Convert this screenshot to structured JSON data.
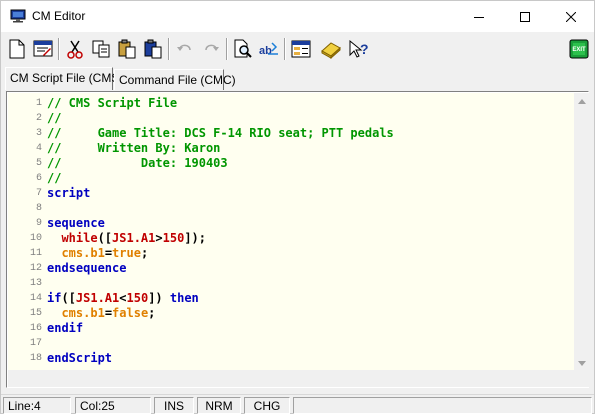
{
  "window": {
    "title": "CM Editor"
  },
  "toolbar": {
    "buttons": [
      {
        "name": "new-file-icon"
      },
      {
        "name": "open-editor-icon"
      },
      {
        "name": "cut-icon"
      },
      {
        "name": "copy-icon"
      },
      {
        "name": "paste-icon"
      },
      {
        "name": "paste-special-icon"
      },
      {
        "name": "undo-icon"
      },
      {
        "name": "redo-icon"
      },
      {
        "name": "find-icon"
      },
      {
        "name": "replace-icon"
      },
      {
        "name": "settings-window-icon"
      },
      {
        "name": "compile-icon"
      },
      {
        "name": "help-icon"
      },
      {
        "name": "exit-icon"
      }
    ],
    "exit_label": "EXIT"
  },
  "tabs": [
    {
      "label": "CM Script File (CMS)",
      "active": true
    },
    {
      "label": "Command File (CMC)",
      "active": false
    }
  ],
  "colors": {
    "comment": "#009600",
    "keyword": "#0000c0",
    "function": "#c00000",
    "variable": "#e08000",
    "background": "#fffff0"
  },
  "editor": {
    "lines": [
      {
        "num": "1",
        "segments": [
          {
            "t": "// CMS Script File",
            "c": "comment"
          }
        ]
      },
      {
        "num": "2",
        "segments": [
          {
            "t": "//",
            "c": "comment"
          }
        ]
      },
      {
        "num": "3",
        "segments": [
          {
            "t": "//     Game Title: DCS F-14 RIO seat; PTT pedals",
            "c": "comment"
          }
        ]
      },
      {
        "num": "4",
        "segments": [
          {
            "t": "//     Written By: Karon",
            "c": "comment"
          }
        ]
      },
      {
        "num": "5",
        "segments": [
          {
            "t": "//           Date: 190403",
            "c": "comment"
          }
        ]
      },
      {
        "num": "6",
        "segments": [
          {
            "t": "//",
            "c": "comment"
          }
        ]
      },
      {
        "num": "7",
        "segments": [
          {
            "t": "script",
            "c": "kw"
          }
        ]
      },
      {
        "num": "8",
        "segments": []
      },
      {
        "num": "9",
        "segments": [
          {
            "t": "sequence",
            "c": "kw"
          }
        ]
      },
      {
        "num": "10",
        "segments": [
          {
            "t": "  ",
            "c": "plain"
          },
          {
            "t": "while",
            "c": "fn"
          },
          {
            "t": "([",
            "c": "plain"
          },
          {
            "t": "JS1.A1",
            "c": "fn"
          },
          {
            "t": ">",
            "c": "plain"
          },
          {
            "t": "150",
            "c": "num"
          },
          {
            "t": "]);",
            "c": "plain"
          }
        ]
      },
      {
        "num": "11",
        "segments": [
          {
            "t": "  ",
            "c": "plain"
          },
          {
            "t": "cms.b1",
            "c": "var"
          },
          {
            "t": "=",
            "c": "plain"
          },
          {
            "t": "true",
            "c": "var"
          },
          {
            "t": ";",
            "c": "plain"
          }
        ]
      },
      {
        "num": "12",
        "segments": [
          {
            "t": "endsequence",
            "c": "kw"
          }
        ]
      },
      {
        "num": "13",
        "segments": []
      },
      {
        "num": "14",
        "segments": [
          {
            "t": "if",
            "c": "kw"
          },
          {
            "t": "([",
            "c": "plain"
          },
          {
            "t": "JS1.A1",
            "c": "fn"
          },
          {
            "t": "<",
            "c": "plain"
          },
          {
            "t": "150",
            "c": "num"
          },
          {
            "t": "]) ",
            "c": "plain"
          },
          {
            "t": "then",
            "c": "kw"
          }
        ]
      },
      {
        "num": "15",
        "segments": [
          {
            "t": "  ",
            "c": "plain"
          },
          {
            "t": "cms.b1",
            "c": "var"
          },
          {
            "t": "=",
            "c": "plain"
          },
          {
            "t": "false",
            "c": "var"
          },
          {
            "t": ";",
            "c": "plain"
          }
        ]
      },
      {
        "num": "16",
        "segments": [
          {
            "t": "endif",
            "c": "kw"
          }
        ]
      },
      {
        "num": "17",
        "segments": []
      },
      {
        "num": "18",
        "segments": [
          {
            "t": "endScript",
            "c": "kw"
          }
        ]
      }
    ]
  },
  "status": {
    "line": "Line:4",
    "col": "Col:25",
    "ins": "INS",
    "nrm": "NRM",
    "chg": "CHG"
  }
}
